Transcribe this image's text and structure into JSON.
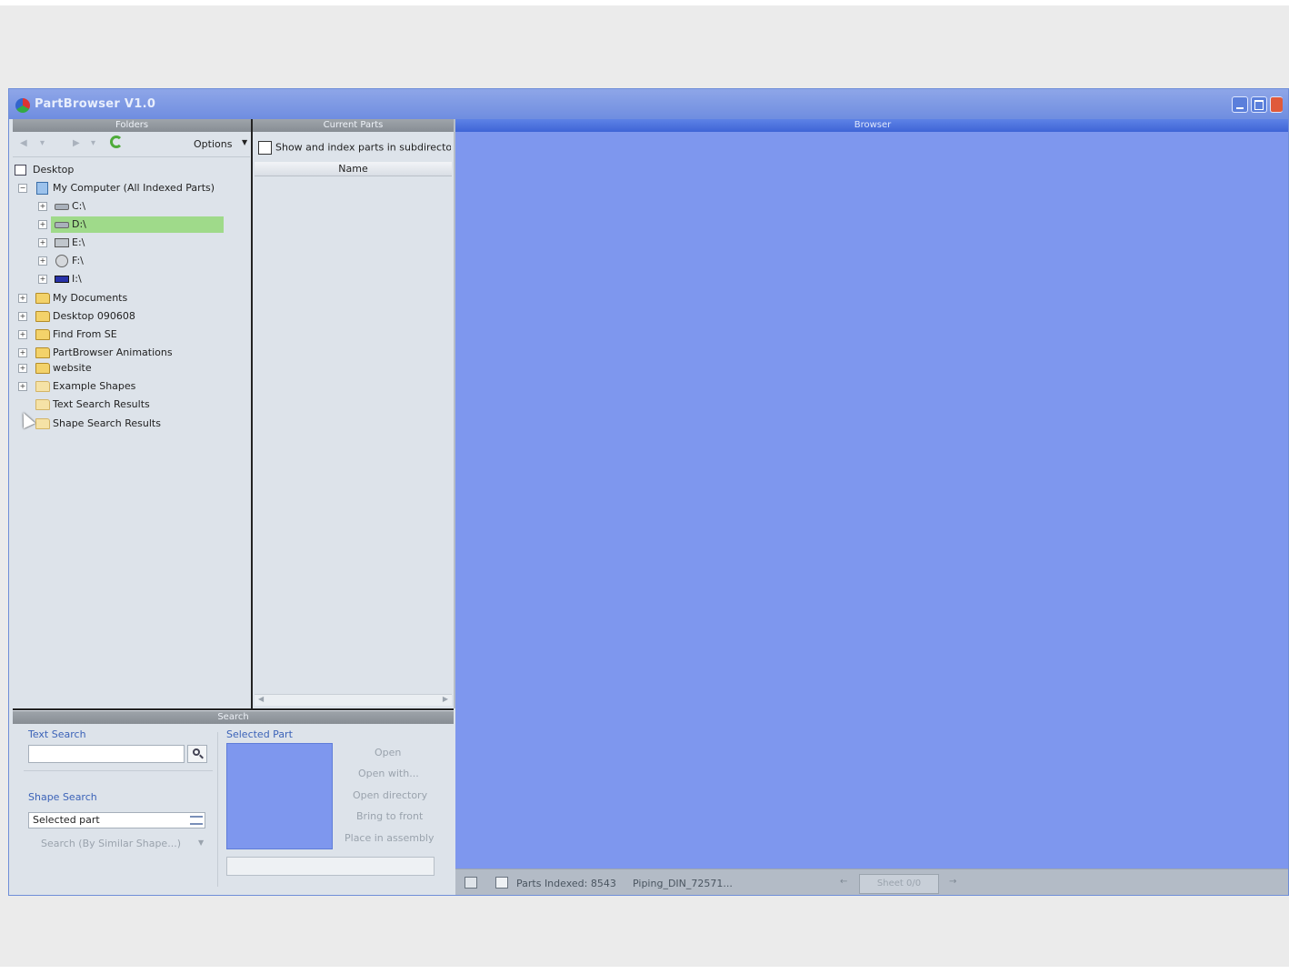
{
  "window": {
    "title": "PartBrowser V1.0"
  },
  "panels": {
    "folders": "Folders",
    "current_parts": "Current Parts",
    "browser": "Browser",
    "search": "Search"
  },
  "folders_toolbar": {
    "options_label": "Options"
  },
  "tree": [
    {
      "label": "Desktop",
      "icon": "desktop-icon"
    },
    {
      "label": "My Computer (All Indexed Parts)",
      "icon": "computer-icon"
    },
    {
      "label": "C:\\",
      "icon": "drive-icon"
    },
    {
      "label": "D:\\",
      "icon": "drive-icon",
      "selected": true
    },
    {
      "label": "E:\\",
      "icon": "dvd-drive-icon"
    },
    {
      "label": "F:\\",
      "icon": "network-drive-icon"
    },
    {
      "label": "I:\\",
      "icon": "usb-drive-icon"
    },
    {
      "label": "My Documents",
      "icon": "folder-icon"
    },
    {
      "label": "Desktop 090608",
      "icon": "folder-icon"
    },
    {
      "label": "Find From SE",
      "icon": "folder-icon"
    },
    {
      "label": "PartBrowser Animations",
      "icon": "folder-icon"
    },
    {
      "label": "website",
      "icon": "folder-icon"
    },
    {
      "label": "Example Shapes",
      "icon": "folder-icon"
    },
    {
      "label": "Text Search Results",
      "icon": "folder-icon"
    },
    {
      "label": "Shape Search Results",
      "icon": "folder-icon"
    }
  ],
  "current_parts": {
    "show_subdirs_label": "Show and index parts in subdirectori",
    "column_name": "Name"
  },
  "search": {
    "text_search_label": "Text Search",
    "text_search_value": "",
    "shape_search_label": "Shape Search",
    "shape_search_value": "Selected part",
    "search_similar_label": "Search (By Similar Shape...)",
    "selected_part_label": "Selected Part",
    "actions": [
      "Open",
      "Open with...",
      "Open directory",
      "Bring to front",
      "Place in assembly"
    ]
  },
  "statusbar": {
    "parts_indexed": "Parts Indexed: 8543",
    "current_part": "Piping_DIN_72571...",
    "sheet_button": "Sheet 0/0"
  },
  "colors": {
    "browser_bg": "#7e97ee",
    "titlebar": "#7b97e4",
    "selection": "#9fda8a"
  }
}
